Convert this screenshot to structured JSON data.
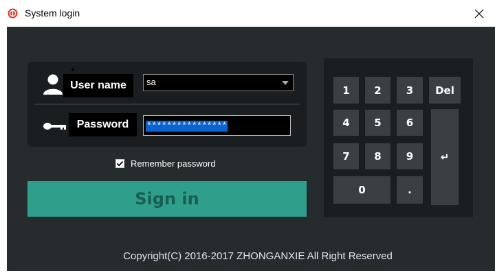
{
  "window": {
    "title": "System login",
    "close_glyph": "✕"
  },
  "login": {
    "username_label": "User name",
    "username_value": "sa",
    "password_label": "Password",
    "password_value": "****************",
    "remember_label": "Remember password",
    "remember_checked": true,
    "signin_label": "Sign in"
  },
  "keypad": {
    "keys": [
      "1",
      "2",
      "3",
      "Del",
      "4",
      "5",
      "6",
      "7",
      "8",
      "9",
      "0",
      ".",
      "↵"
    ]
  },
  "footer": {
    "copyright": "Copyright(C) 2016-2017 ZHONGANXIE All Right Reserved"
  },
  "colors": {
    "background": "#262b2d",
    "panel": "#1a1e20",
    "accent": "#2f9f8c",
    "app_icon": "#d23a2a"
  },
  "icons": {
    "app": "app-logo-icon",
    "user": "user-icon",
    "password": "key-icon",
    "close": "close-icon",
    "dropdown": "dropdown-arrow-icon",
    "check": "check-icon",
    "enter": "enter-icon"
  }
}
